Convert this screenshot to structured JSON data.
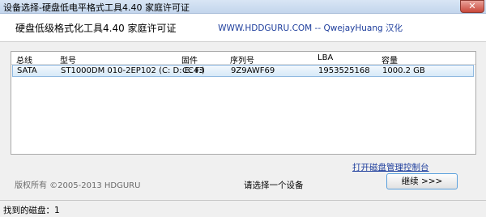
{
  "window": {
    "title": "设备选择-硬盘低电平格式工具4.40   家庭许可证"
  },
  "header": {
    "app_name": "硬盘低级格式化工具4.40   家庭许可证",
    "site_link": "WWW.HDDGURU.COM -- QwejayHuang 汉化"
  },
  "table": {
    "columns": [
      "总线",
      "型号",
      "固件",
      "序列号",
      "LBA",
      "容量"
    ],
    "rows": [
      [
        "SATA",
        "ST1000DM 010-2EP102 (C: D: E: F:)",
        "CC43",
        "9Z9AWF69",
        "1953525168",
        "1000.2 GB"
      ]
    ]
  },
  "footer": {
    "manage_link": "打开磁盘管理控制台",
    "copyright": "版权所有 ©2005-2013 HDGURU",
    "prompt": "请选择一个设备",
    "continue_label": "继续 >>>"
  },
  "status": {
    "text": "找到的磁盘：1"
  },
  "icons": {
    "close": "close-icon"
  }
}
